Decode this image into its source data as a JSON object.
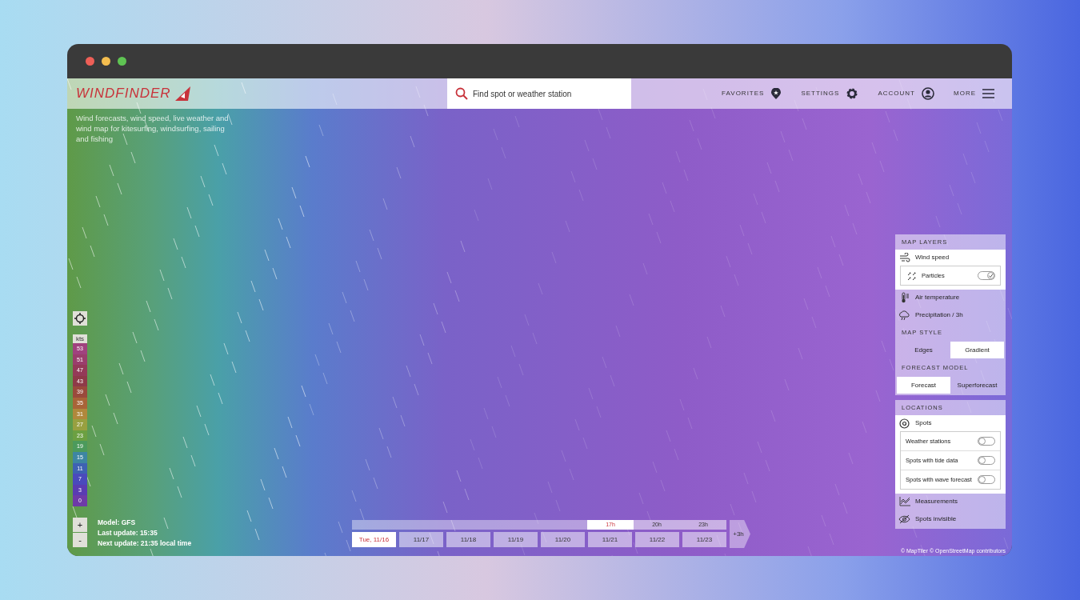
{
  "header": {
    "logo": "WINDFINDER",
    "search": {
      "placeholder": "Find spot or weather station"
    },
    "nav": [
      {
        "label": "FAVORITES",
        "kind": "pin"
      },
      {
        "label": "SETTINGS",
        "kind": "gear"
      },
      {
        "label": "ACCOUNT",
        "kind": "user"
      },
      {
        "label": "MORE",
        "kind": "menu"
      }
    ]
  },
  "tagline": "Wind forecasts, wind speed, live weather and wind map for kitesurfing, windsurfing, sailing and fishing",
  "legend": {
    "unit": "kts",
    "steps": [
      {
        "label": "53",
        "color": "#a0427e"
      },
      {
        "label": "51",
        "color": "#9a3e6c"
      },
      {
        "label": "47",
        "color": "#943a58"
      },
      {
        "label": "43",
        "color": "#8e3a48"
      },
      {
        "label": "39",
        "color": "#9a4a3c"
      },
      {
        "label": "35",
        "color": "#a86438"
      },
      {
        "label": "31",
        "color": "#b0883c"
      },
      {
        "label": "27",
        "color": "#98a040"
      },
      {
        "label": "23",
        "color": "#6ca042"
      },
      {
        "label": "19",
        "color": "#4c9a5c"
      },
      {
        "label": "15",
        "color": "#3e86a2"
      },
      {
        "label": "11",
        "color": "#3e62b2"
      },
      {
        "label": "7",
        "color": "#4a4abc"
      },
      {
        "label": "3",
        "color": "#5a3cb2"
      },
      {
        "label": "0",
        "color": "#6e3aa8"
      }
    ]
  },
  "zoom": {
    "in": "+",
    "out": "-"
  },
  "model_info": [
    "Model: GFS",
    "Last update: 15:35",
    "Next update: 21:35 local time"
  ],
  "timeline": {
    "hours": [
      {
        "label": "17h",
        "selected": true
      },
      {
        "label": "20h",
        "selected": false
      },
      {
        "label": "23h",
        "selected": false
      }
    ],
    "days": [
      {
        "label": "Tue, 11/16",
        "selected": true
      },
      {
        "label": "11/17",
        "selected": false
      },
      {
        "label": "11/18",
        "selected": false
      },
      {
        "label": "11/19",
        "selected": false
      },
      {
        "label": "11/20",
        "selected": false
      },
      {
        "label": "11/21",
        "selected": false
      },
      {
        "label": "11/22",
        "selected": false
      },
      {
        "label": "11/23",
        "selected": false
      }
    ],
    "next": "+3h"
  },
  "panel": {
    "map_layers": {
      "title": "MAP LAYERS",
      "items": [
        {
          "label": "Wind speed",
          "kind": "wind",
          "selected": true,
          "options": [
            {
              "label": "Particles",
              "kind": "particles",
              "on": true
            }
          ]
        },
        {
          "label": "Air temperature",
          "kind": "thermometer",
          "selected": false
        },
        {
          "label": "Precipitation / 3h",
          "kind": "rain",
          "selected": false
        }
      ]
    },
    "map_style": {
      "title": "MAP STYLE",
      "options": [
        {
          "label": "Edges",
          "selected": false
        },
        {
          "label": "Gradient",
          "selected": true
        }
      ]
    },
    "forecast_model": {
      "title": "FORECAST MODEL",
      "options": [
        {
          "label": "Forecast",
          "selected": true
        },
        {
          "label": "Superforecast",
          "selected": false
        }
      ]
    },
    "locations": {
      "title": "LOCATIONS",
      "items": [
        {
          "label": "Spots",
          "kind": "target",
          "selected": true,
          "options": [
            {
              "label": "Weather stations",
              "on": false
            },
            {
              "label": "Spots with tide data",
              "on": false
            },
            {
              "label": "Spots with wave forecast",
              "on": false
            }
          ]
        },
        {
          "label": "Measurements",
          "kind": "chart",
          "selected": false
        },
        {
          "label": "Spots invisible",
          "kind": "eye-off",
          "selected": false
        }
      ]
    }
  },
  "attribution": "© MapTiler © OpenStreetMap contributors"
}
